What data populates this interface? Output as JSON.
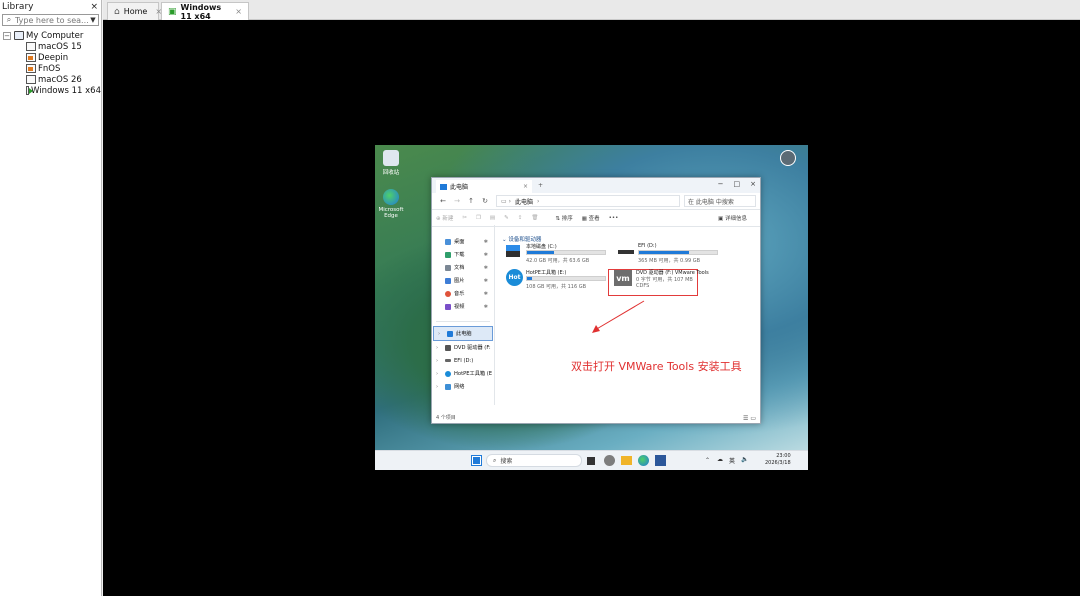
{
  "library": {
    "title": "Library",
    "close": "×",
    "search_placeholder": "Type here to sea...",
    "root": "My Computer",
    "vms": [
      {
        "name": "macOS 15",
        "state": "normal"
      },
      {
        "name": "Deepin",
        "state": "warn"
      },
      {
        "name": "FnOS",
        "state": "warn"
      },
      {
        "name": "macOS 26",
        "state": "normal"
      },
      {
        "name": "Windows 11 x64",
        "state": "running"
      }
    ]
  },
  "tabs": [
    {
      "label": "Home",
      "icon": "home-icon"
    },
    {
      "label": "Windows 11 x64",
      "icon": "vm-running-icon"
    }
  ],
  "guest": {
    "explorer": {
      "window_title": "此电脑",
      "address": "此电脑",
      "search": "在 此电脑 中搜索",
      "toolbar": [
        "新建",
        "排序",
        "查看",
        "•••",
        "详细信息"
      ],
      "nav": [
        "桌面",
        "下载",
        "文档",
        "图片",
        "音乐",
        "视频",
        "此电脑",
        "DVD 驱动器 (F:",
        "EFI (D:)",
        "HotPE工具箱 (E",
        "网络"
      ],
      "section": "设备和驱动器",
      "drives": [
        {
          "name": "本地磁盘 (C:)",
          "size": "42.0 GB 可用，共 63.6 GB",
          "fill": 0.34
        },
        {
          "name": "EFI (D:)",
          "size": "365 MB 可用，共 0.99 GB",
          "fill": 0.64
        },
        {
          "name": "HotPE工具箱 (E:)",
          "size": "108 GB 可用，共 116 GB",
          "fill": 0.07
        },
        {
          "name": "DVD 驱动器 (F:) VMware Tools",
          "size": "0 字节 可用，共 107 MB",
          "fs": "CDFS"
        }
      ],
      "status": "4 个项目"
    },
    "annotation": "双击打开 VMWare Tools 安装工具",
    "taskbar": {
      "search": "搜索",
      "lang": "英",
      "time": "23:00",
      "date": "2026/3/18"
    },
    "desktop_icons": [
      "回收站",
      "Microsoft Edge"
    ]
  }
}
